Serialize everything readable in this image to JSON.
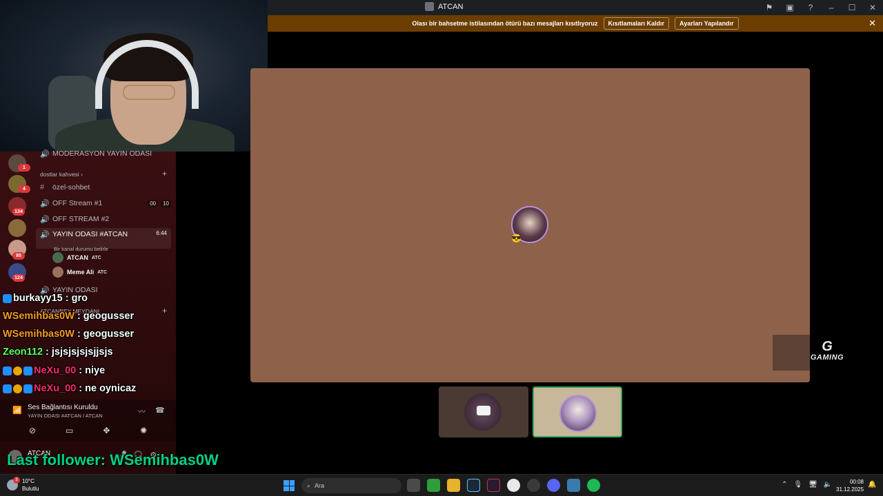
{
  "window": {
    "title": "ATCAN"
  },
  "notice": {
    "text": "Olası bir bahsetme istilasından ötürü bazı mesajları kısıtlıyoruz",
    "btn_remove": "Kısıtlamaları Kaldır",
    "btn_settings": "Ayarları Yapılandır"
  },
  "guild_badges": [
    "1",
    "4",
    "134",
    "85",
    "124"
  ],
  "channels": {
    "moderation": "MODERASYON YAYIN ODASI",
    "category1": "dostlar kahvesi",
    "ozel_sohbet": "özel-sohbet",
    "off1": "OFF Stream #1",
    "off1_pills": [
      "00",
      "10"
    ],
    "off2": "OFF STREAM #2",
    "active": "YAYIN ODASI #ATCAN",
    "active_time": "6:44",
    "active_status": "Bir kanal durumu belirle",
    "members": [
      {
        "name": "ATCAN",
        "tag": "ATC"
      },
      {
        "name": "Meme Ali",
        "tag": "ATC"
      }
    ],
    "yayin": "YAYIN ODASI",
    "category2": "ATCANBEY MEYDANI"
  },
  "chat": [
    {
      "user": "burkayy15",
      "msg": ": gro",
      "color": "#ffffff"
    },
    {
      "user": "WSemihbas0W",
      "msg": ": geogusser",
      "color": "#ff9a1f"
    },
    {
      "user": "WSemihbas0W",
      "msg": ": geogusser",
      "color": "#ff9a1f"
    },
    {
      "user": "Zeon112",
      "msg": ": jsjsjsjsjsjjsjs",
      "color": "#5cff5c"
    },
    {
      "user": "NeXu_00",
      "msg": ": niye",
      "color": "#ff2a6d"
    },
    {
      "user": "NeXu_00",
      "msg": ": ne oynicaz",
      "color": "#ff2a6d"
    }
  ],
  "voice": {
    "status": "Ses Bağlantısı Kuruldu",
    "channel": "YAYIN ODASI #ATCAN / ATCAN"
  },
  "user": {
    "name": "ATCAN"
  },
  "follower": "Last follower: WSemihbas0W",
  "logo": {
    "line1": "G",
    "line2": "GAMING"
  },
  "taskbar": {
    "temp": "10°C",
    "weather": "Bulutlu",
    "search": "Ara",
    "weather_badge": "3",
    "time": "00:08",
    "date": "31.12.2025"
  }
}
